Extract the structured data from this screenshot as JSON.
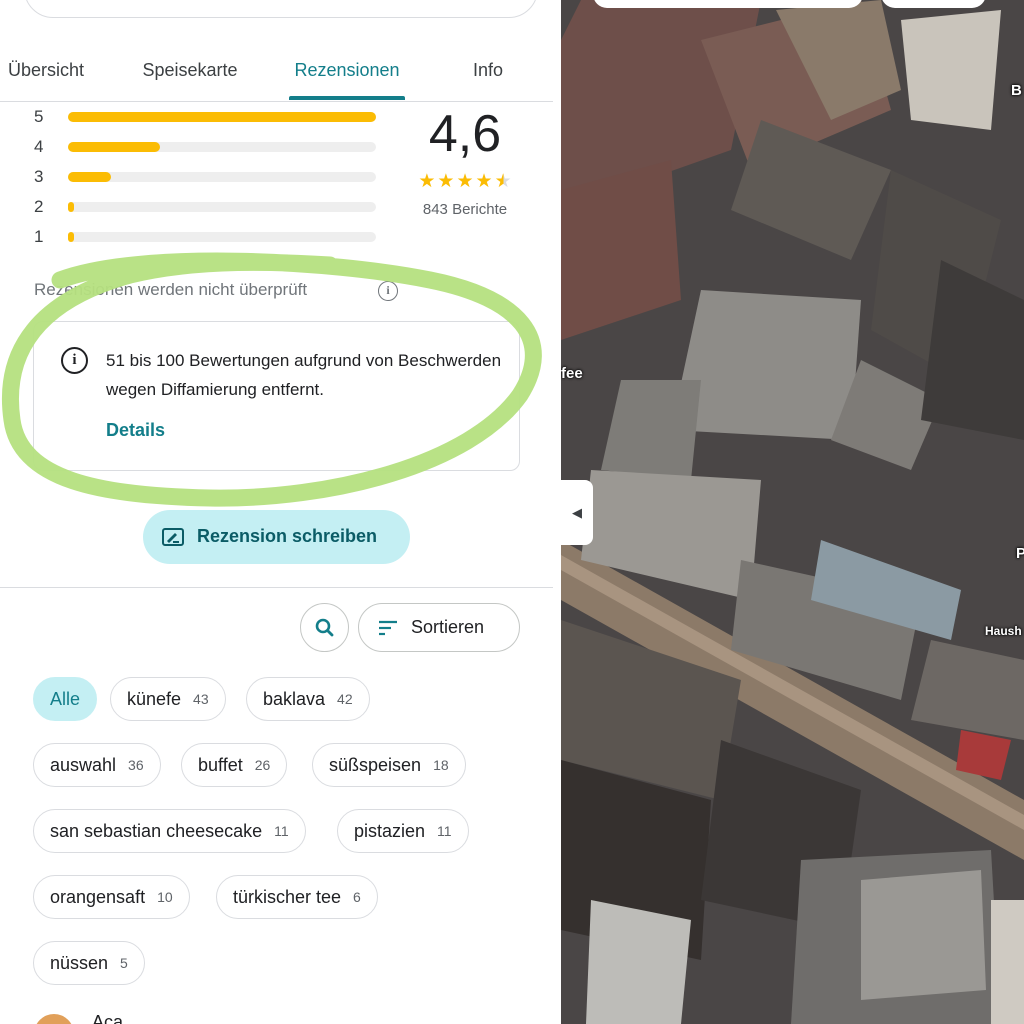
{
  "tabs": [
    {
      "label": "Übersicht"
    },
    {
      "label": "Speisekarte"
    },
    {
      "label": "Rezensionen"
    },
    {
      "label": "Info"
    }
  ],
  "histogram": [
    {
      "label": "5",
      "fraction": 1.0
    },
    {
      "label": "4",
      "fraction": 0.3
    },
    {
      "label": "3",
      "fraction": 0.14
    },
    {
      "label": "2",
      "fraction": 0.02
    },
    {
      "label": "1",
      "fraction": 0.02
    }
  ],
  "rating": {
    "value": "4,6",
    "stars": 4.6,
    "count_label": "843 Berichte"
  },
  "not_verified_label": "Rezensionen werden nicht überprüft",
  "notice": {
    "text": "51 bis 100 Bewertungen aufgrund von Beschwerden wegen Diffamierung entfernt.",
    "link_label": "Details"
  },
  "write_review_label": "Rezension schreiben",
  "sort_label": "Sortieren",
  "chips": [
    {
      "text": "Alle",
      "count": "",
      "selected": true
    },
    {
      "text": "künefe",
      "count": "43"
    },
    {
      "text": "baklava",
      "count": "42"
    },
    {
      "text": "auswahl",
      "count": "36"
    },
    {
      "text": "buffet",
      "count": "26"
    },
    {
      "text": "süßspeisen",
      "count": "18"
    },
    {
      "text": "san sebastian cheesecake",
      "count": "11"
    },
    {
      "text": "pistazien",
      "count": "11"
    },
    {
      "text": "orangensaft",
      "count": "10"
    },
    {
      "text": "türkischer tee",
      "count": "6"
    },
    {
      "text": "nüssen",
      "count": "5"
    }
  ],
  "first_reviewer": "Aca",
  "map": {
    "labels": [
      "fee",
      "B",
      "P",
      "Haush"
    ]
  },
  "colors": {
    "accent": "#137e8a",
    "star": "#fbbc04",
    "chip_selected_bg": "#c4eff3",
    "annotation": "#b5e07f"
  }
}
